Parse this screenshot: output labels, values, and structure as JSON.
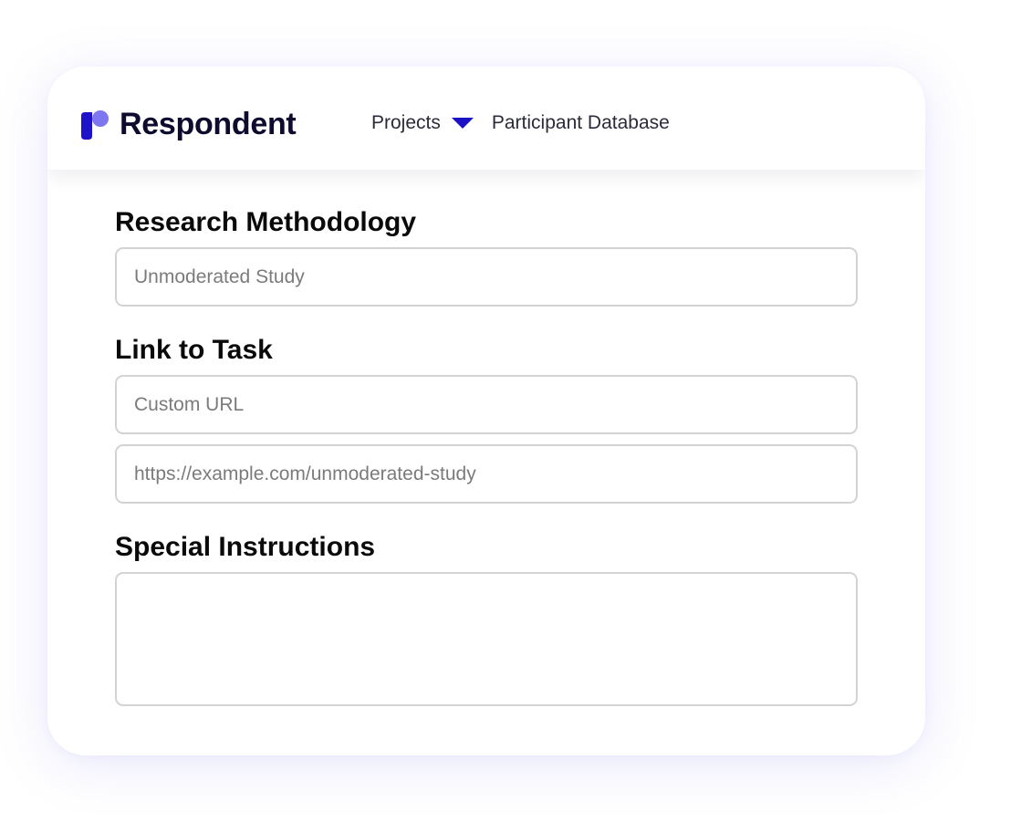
{
  "brand": {
    "name": "Respondent",
    "logo_icon": "respondent-logo-icon",
    "colors": {
      "logo_dark": "#1f13c9",
      "logo_light": "#7e76f0",
      "text": "#0d0b2e"
    }
  },
  "nav": {
    "projects_label": "Projects",
    "projects_caret_icon": "caret-down-icon",
    "caret_color": "#1a12c4",
    "participant_database_label": "Participant Database"
  },
  "form": {
    "methodology": {
      "label": "Research Methodology",
      "placeholder": "Unmoderated Study"
    },
    "task_link": {
      "label": "Link to Task",
      "type_placeholder": "Custom URL",
      "url_placeholder": "https://example.com/unmoderated-study"
    },
    "instructions": {
      "label": "Special Instructions",
      "placeholder": ""
    }
  }
}
